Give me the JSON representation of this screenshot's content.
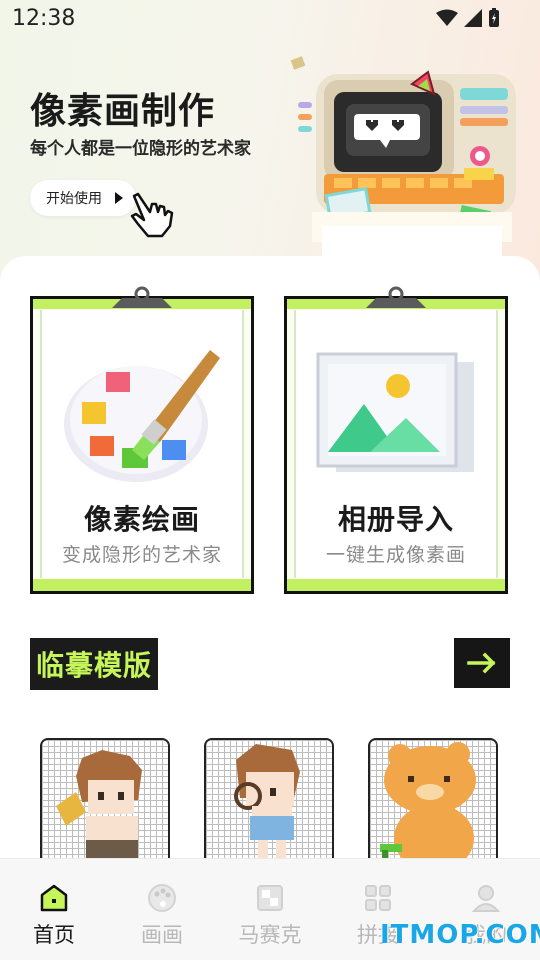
{
  "status_bar": {
    "time": "12:38"
  },
  "hero": {
    "title": "像素画制作",
    "subtitle": "每个人都是一位隐形的艺术家",
    "start_button": "开始使用"
  },
  "cards": [
    {
      "title": "像素绘画",
      "subtitle": "变成隐形的艺术家",
      "icon": "palette-icon"
    },
    {
      "title": "相册导入",
      "subtitle": "一键生成像素画",
      "icon": "photo-gallery-icon"
    }
  ],
  "templates_section": {
    "title": "临摹模版",
    "more_icon": "arrow-right-icon"
  },
  "templates": [
    {
      "name": "boy-with-trumpet"
    },
    {
      "name": "girl-with-magnifier"
    },
    {
      "name": "orange-bear"
    }
  ],
  "bottom_nav": [
    {
      "label": "首页",
      "icon": "home-icon",
      "active": true
    },
    {
      "label": "画画",
      "icon": "palette-icon",
      "active": false
    },
    {
      "label": "马赛克",
      "icon": "mosaic-icon",
      "active": false
    },
    {
      "label": "拼接",
      "icon": "grid-icon",
      "active": false
    },
    {
      "label": "我的",
      "icon": "user-icon",
      "active": false
    }
  ],
  "watermark": "ITMOP.COM",
  "colors": {
    "accent": "#c3f060",
    "dark": "#161616",
    "inactive": "#b8b8b8"
  }
}
